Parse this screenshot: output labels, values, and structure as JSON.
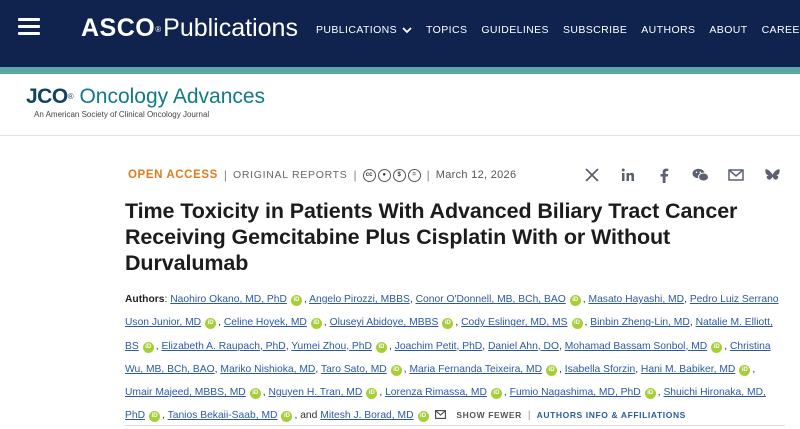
{
  "nav": {
    "brand_bold": "ASCO",
    "brand_reg": "®",
    "brand_rest": "Publications",
    "links": [
      "PUBLICATIONS",
      "TOPICS",
      "GUIDELINES",
      "SUBSCRIBE",
      "AUTHORS",
      "ABOUT",
      "CAREERS"
    ]
  },
  "journal": {
    "jco": "JCO",
    "reg": "®",
    "name": "Oncology Advances",
    "subtitle": "An American Society of Clinical Oncology Journal"
  },
  "article": {
    "access": "OPEN ACCESS",
    "type": "ORIGINAL REPORTS",
    "license_icons": [
      "cc",
      "by",
      "nc",
      "nd"
    ],
    "date": "March 12, 2026",
    "title": "Time Toxicity in Patients With Advanced Biliary Tract Cancer Receiving Gemcitabine Plus Cisplatin With or Without Durvalumab",
    "authors_label": "Authors",
    "authors": [
      "Naohiro Okano, MD, PhD",
      "Angelo Pirozzi, MBBS",
      "Conor O'Donnell, MB, BCh, BAO",
      "Masato Hayashi, MD",
      "Pedro Luiz Serrano Uson Junior, MD",
      "Celine Hoyek, MD",
      "Oluseyi Abidoye, MBBS",
      "Cody Eslinger, MD, MS",
      "Binbin Zheng-Lin, MD",
      "Natalie M. Elliott, BS",
      "Elizabeth A. Raupach, PhD",
      "Yumei Zhou, PhD",
      "Joachim Petit, PhD",
      "Daniel Ahn, DO",
      "Mohamad Bassam Sonbol, MD",
      "Christina Wu, MB, BCh, BAO",
      "Mariko Nishioka, MD",
      "Taro Sato, MD",
      "Maria Fernanda Teixeira, MD",
      "Isabella Sforzin",
      "Hani M. Babiker, MD",
      "Umair Majeed, MBBS, MD",
      "Nguyen H. Tran, MD",
      "Lorenza Rimassa, MD",
      "Fumio Nagashima, MD, PhD",
      "Shuichi Hironaka, MD, PhD",
      "Tanios Bekaii-Saab, MD",
      "Mitesh J. Borad, MD"
    ],
    "and_text": ", and",
    "show_fewer": "SHOW FEWER",
    "affiliations": "AUTHORS INFO & AFFILIATIONS"
  },
  "share_icons": [
    "x-icon",
    "linkedin-icon",
    "facebook-icon",
    "wechat-icon",
    "email-icon",
    "bluesky-icon"
  ]
}
